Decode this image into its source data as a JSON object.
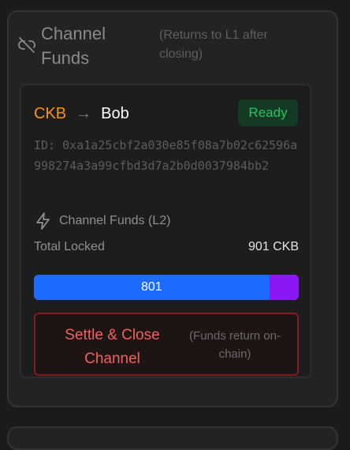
{
  "section": {
    "title": "Channel Funds",
    "note": "(Returns to L1 after closing)",
    "icon": "link-broken-icon"
  },
  "channel": {
    "from": "CKB",
    "arrow": "→",
    "to": "Bob",
    "status": "Ready",
    "id": "ID: 0xa1a25cbf2a030e85f08a7b02c62596a998274a3a99cfbd3d7a2b0d0037984bb2",
    "funds_label": "Channel Funds (L2)",
    "funds_icon": "lightning-bolt-icon",
    "total_locked_label": "Total Locked",
    "total_locked_value": "901 CKB",
    "bar_value": "801",
    "bar_fraction": 0.889
  },
  "actions": {
    "settle_label": "Settle & Close Channel",
    "settle_note": "(Funds return on-chain)"
  },
  "colors": {
    "from": "#f7931a",
    "status": "#22c55e",
    "bar_primary": "#1d6bff",
    "bar_secondary": "#8b17f5",
    "danger": "#f26060"
  }
}
